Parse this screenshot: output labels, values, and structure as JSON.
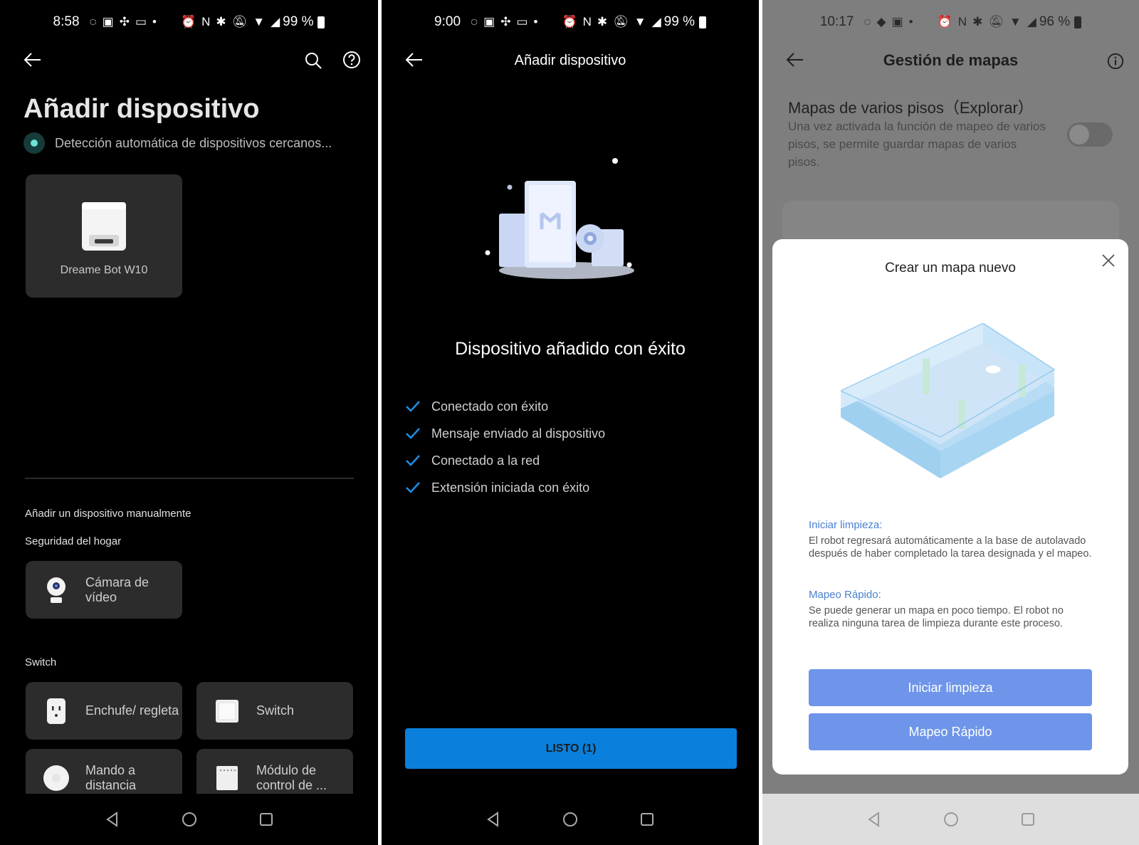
{
  "screen1": {
    "status": {
      "time": "8:58",
      "battery": "99 %"
    },
    "title": "Añadir dispositivo",
    "detecting_text": "Detección automática de dispositivos cercanos...",
    "found_device": {
      "name": "Dreame Bot W10"
    },
    "manual_label": "Añadir un dispositivo manualmente",
    "sections": [
      {
        "title": "Seguridad del hogar",
        "items": [
          {
            "label": "Cámara de vídeo"
          }
        ]
      },
      {
        "title": "Switch",
        "items": [
          {
            "label": "Enchufe/ regleta"
          },
          {
            "label": "Switch"
          },
          {
            "label": "Mando a distancia"
          },
          {
            "label": "Módulo de control de ..."
          }
        ]
      }
    ]
  },
  "screen2": {
    "status": {
      "time": "9:00",
      "battery": "99 %"
    },
    "title": "Añadir dispositivo",
    "success_text": "Dispositivo añadido con éxito",
    "checks": [
      "Conectado con éxito",
      "Mensaje enviado al dispositivo",
      "Conectado a la red",
      "Extensión iniciada con éxito"
    ],
    "done_button": "LISTO (1)"
  },
  "screen3": {
    "status": {
      "time": "10:17",
      "battery": "96 %"
    },
    "title": "Gestión de mapas",
    "multifloor": {
      "title": "Mapas de varios pisos（Explorar）",
      "description": "Una vez activada la función de mapeo de varios pisos, se permite guardar mapas de varios pisos.",
      "enabled": false
    },
    "modal": {
      "title": "Crear un mapa nuevo",
      "option1_title": "Iniciar limpieza:",
      "option1_desc": "El robot regresará automáticamente a la base de autolavado después de haber completado la tarea designada y el mapeo.",
      "option2_title": "Mapeo Rápido:",
      "option2_desc": "Se puede generar un mapa en poco tiempo. El robot no realiza ninguna tarea de limpieza durante este proceso.",
      "button1": "Iniciar limpieza",
      "button2": "Mapeo Rápido"
    }
  },
  "colors": {
    "accent_blue": "#0a80dc",
    "modal_button": "#6e95e9",
    "check": "#1e8fe6",
    "teal_dot": "#6fe0d4"
  }
}
